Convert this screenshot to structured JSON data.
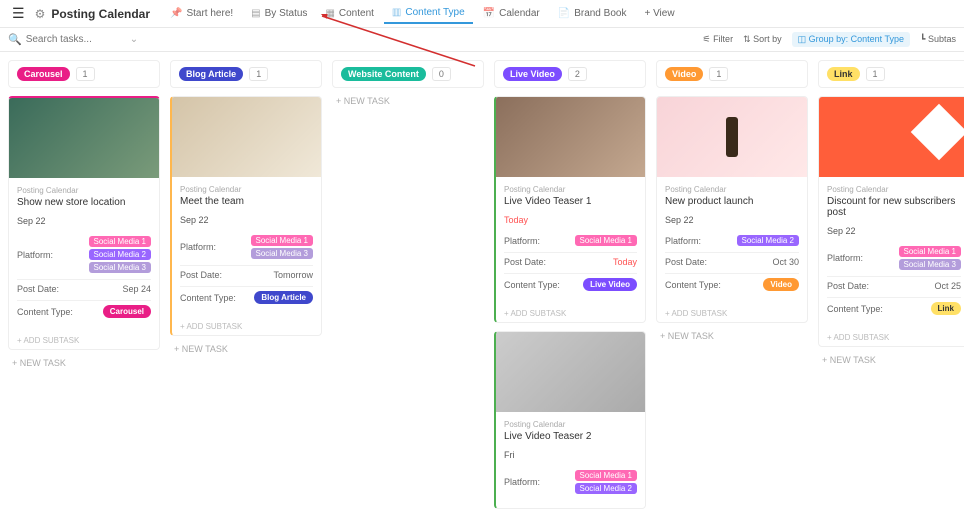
{
  "topbar": {
    "title": "Posting Calendar",
    "tabs": [
      {
        "label": "Start here!"
      },
      {
        "label": "By Status"
      },
      {
        "label": "Content"
      },
      {
        "label": "Content Type"
      },
      {
        "label": "Calendar"
      },
      {
        "label": "Brand Book"
      }
    ],
    "add_view": "+ View"
  },
  "search": {
    "placeholder": "Search tasks...",
    "filter": "Filter",
    "sort": "Sort by",
    "group": "Group by: Content Type",
    "subtask": "Subtas"
  },
  "columns": [
    {
      "chip": "Carousel",
      "cls": "chip-carousel",
      "count": "1"
    },
    {
      "chip": "Blog Article",
      "cls": "chip-blog",
      "count": "1"
    },
    {
      "chip": "Website Content",
      "cls": "chip-website",
      "count": "0"
    },
    {
      "chip": "Live Video",
      "cls": "chip-livevideo",
      "count": "2"
    },
    {
      "chip": "Video",
      "cls": "chip-video",
      "count": "1"
    },
    {
      "chip": "Link",
      "cls": "chip-link",
      "count": "1"
    }
  ],
  "labels": {
    "platform": "Platform:",
    "postdate": "Post Date:",
    "contenttype": "Content Type:",
    "newtask": "+ NEW TASK",
    "addsub": "+ ADD SUBTASK",
    "cat": "Posting Calendar"
  },
  "cards": {
    "c1": {
      "title": "Show new store location",
      "date": "Sep 22",
      "post": "Sep 24",
      "ctype": "Carousel"
    },
    "c2": {
      "title": "Meet the team",
      "date": "Sep 22",
      "post": "Tomorrow",
      "ctype": "Blog Article"
    },
    "c3": {
      "title": "Live Video Teaser 1",
      "date": "Today",
      "post": "Today",
      "ctype": "Live Video"
    },
    "c4": {
      "title": "New product launch",
      "date": "Sep 22",
      "post": "Oct 30"
    },
    "c5": {
      "title": "Discount for new subscribers post",
      "date": "Sep 22",
      "post": "Oct 25",
      "ctype": "Link"
    },
    "c6": {
      "title": "Live Video Teaser 2",
      "date": "Fri"
    }
  },
  "tags": {
    "sm1": "Social Media 1",
    "sm2": "Social Media 2",
    "sm3": "Social Media 3"
  }
}
